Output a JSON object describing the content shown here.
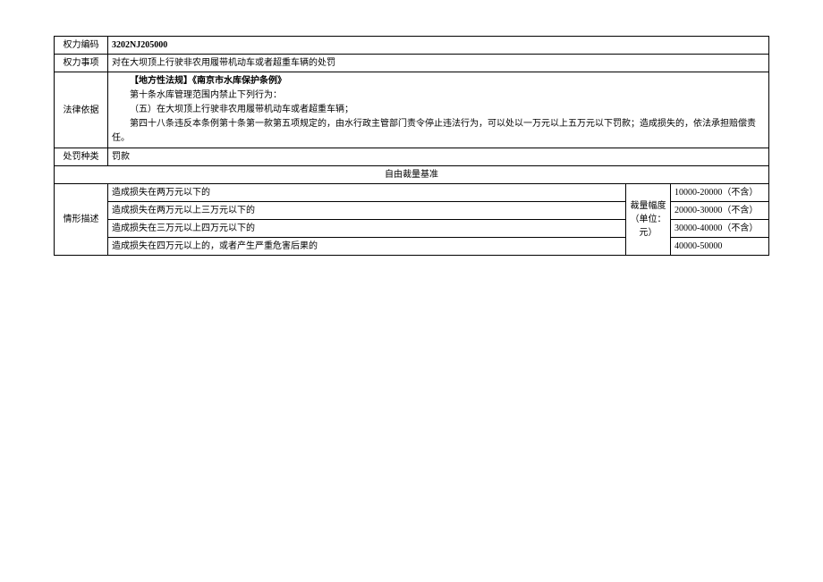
{
  "labels": {
    "code": "权力编码",
    "item": "权力事项",
    "legal": "法律依据",
    "penalty": "处罚种类",
    "discretion_header": "自由裁量基准",
    "situation": "情形描述",
    "range_label": "裁量幅度（单位：元）"
  },
  "code_value": "3202NJ205000",
  "item_value": "对在大坝顶上行驶非农用履带机动车或者超重车辆的处罚",
  "legal_lines": {
    "l1": "【地方性法规】《南京市水库保护条例》",
    "l2": "第十条水库管理范围内禁止下列行为：",
    "l3": "（五）在大坝顶上行驶非农用履带机动车或者超重车辆；",
    "l4": "第四十八条违反本条例第十条第一款第五项规定的，由水行政主管部门责令停止违法行为，可以处以一万元以上五万元以下罚款；造成损失的，依法承担赔偿责任。"
  },
  "penalty_value": "罚款",
  "situations": [
    {
      "desc": "造成损失在两万元以下的",
      "range": "10000-20000（不含）"
    },
    {
      "desc": "造成损失在两万元以上三万元以下的",
      "range": "20000-30000（不含）"
    },
    {
      "desc": "造成损失在三万元以上四万元以下的",
      "range": "30000-40000（不含）"
    },
    {
      "desc": "造成损失在四万元以上的，或者产生严重危害后果的",
      "range": "40000-50000"
    }
  ]
}
